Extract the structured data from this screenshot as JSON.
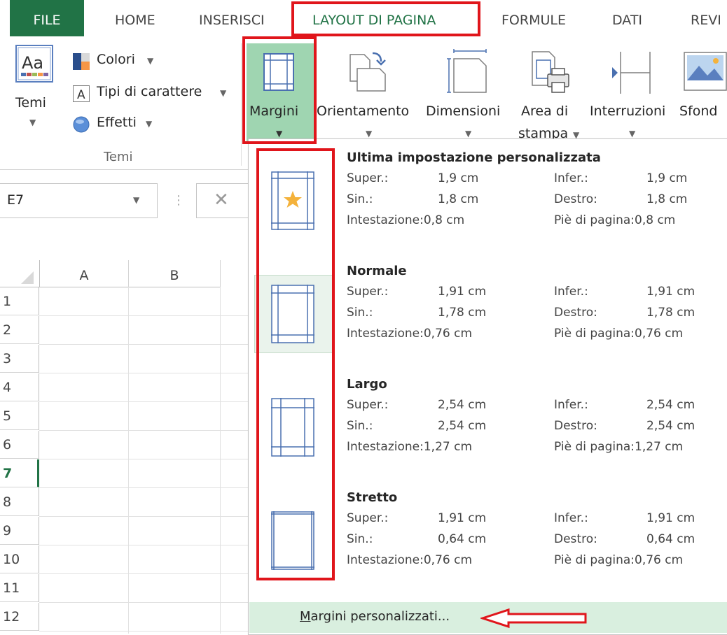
{
  "tabs": [
    {
      "label": "FILE"
    },
    {
      "label": "HOME"
    },
    {
      "label": "INSERISCI"
    },
    {
      "label": "LAYOUT DI PAGINA"
    },
    {
      "label": "FORMULE"
    },
    {
      "label": "DATI"
    },
    {
      "label": "REVI"
    }
  ],
  "ribbon": {
    "themes": {
      "temi_label": "Temi",
      "colori": "Colori",
      "tipi_carattere": "Tipi di carattere",
      "effetti": "Effetti",
      "group_label": "Temi"
    },
    "buttons": {
      "margini": "Margini",
      "orientamento": "Orientamento",
      "dimensioni": "Dimensioni",
      "area_line1": "Area di",
      "area_line2": "stampa",
      "interruzioni": "Interruzioni",
      "sfondo": "Sfond"
    }
  },
  "namebox": {
    "value": "E7"
  },
  "grid": {
    "columns": [
      "A",
      "B"
    ],
    "rows": [
      "1",
      "2",
      "3",
      "4",
      "5",
      "6",
      "7",
      "8",
      "9",
      "10",
      "11",
      "12"
    ],
    "selected_row": "7"
  },
  "menu": {
    "items": [
      {
        "title": "Ultima impostazione personalizzata",
        "super_label": "Super.:",
        "super_val": "1,9 cm",
        "infer_label": "Infer.:",
        "infer_val": "1,9 cm",
        "sin_label": "Sin.:",
        "sin_val": "1,8 cm",
        "destro_label": "Destro:",
        "destro_val": "1,8 cm",
        "intest": "Intestazione:0,8 cm",
        "piede": "Piè di pagina:0,8 cm"
      },
      {
        "title": "Normale",
        "super_label": "Super.:",
        "super_val": "1,91 cm",
        "infer_label": "Infer.:",
        "infer_val": "1,91 cm",
        "sin_label": "Sin.:",
        "sin_val": "1,78 cm",
        "destro_label": "Destro:",
        "destro_val": "1,78 cm",
        "intest": "Intestazione:0,76 cm",
        "piede": "Piè di pagina:0,76 cm"
      },
      {
        "title": "Largo",
        "super_label": "Super.:",
        "super_val": "2,54 cm",
        "infer_label": "Infer.:",
        "infer_val": "2,54 cm",
        "sin_label": "Sin.:",
        "sin_val": "2,54 cm",
        "destro_label": "Destro:",
        "destro_val": "2,54 cm",
        "intest": "Intestazione:1,27 cm",
        "piede": "Piè di pagina:1,27 cm"
      },
      {
        "title": "Stretto",
        "super_label": "Super.:",
        "super_val": "1,91 cm",
        "infer_label": "Infer.:",
        "infer_val": "1,91 cm",
        "sin_label": "Sin.:",
        "sin_val": "0,64 cm",
        "destro_label": "Destro:",
        "destro_val": "0,64 cm",
        "intest": "Intestazione:0,76 cm",
        "piede": "Piè di pagina:0,76 cm"
      }
    ],
    "custom_first": "M",
    "custom_rest": "argini personalizzati..."
  },
  "colors": {
    "excel_green": "#217346",
    "annotation_red": "#e0151b",
    "margin_line_blue": "#4a70b0",
    "star_orange": "#f4b23b",
    "hover_green": "#d9efdf"
  }
}
